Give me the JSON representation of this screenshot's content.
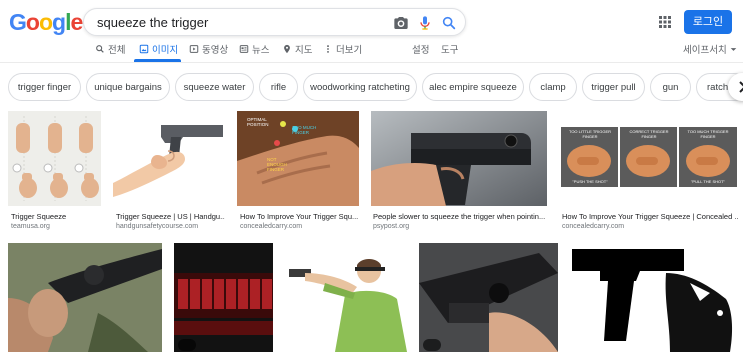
{
  "header": {
    "logo": "Google",
    "logo_colors": [
      "#4285f4",
      "#ea4335",
      "#fbbc05",
      "#4285f4",
      "#34a853",
      "#ea4335"
    ],
    "search_query": "squeeze the trigger",
    "login_label": "로그인"
  },
  "tabs": [
    {
      "label": "전체",
      "icon": "search-icon"
    },
    {
      "label": "이미지",
      "icon": "image-icon",
      "active": true
    },
    {
      "label": "동영상",
      "icon": "video-icon"
    },
    {
      "label": "뉴스",
      "icon": "news-icon"
    },
    {
      "label": "지도",
      "icon": "map-pin-icon"
    },
    {
      "label": "더보기",
      "icon": "more-icon"
    }
  ],
  "tools": {
    "settings": "설정",
    "tools": "도구",
    "safesearch": "세이프서치"
  },
  "chips": [
    "trigger finger",
    "unique bargains",
    "squeeze water",
    "rifle",
    "woodworking ratcheting",
    "alec empire squeeze",
    "clamp",
    "trigger pull",
    "gun",
    "ratche"
  ],
  "results_row1": [
    {
      "title": "Trigger Squeeze",
      "source": "teamusa.org"
    },
    {
      "title": "Trigger Squeeze | US | Handgu...",
      "source": "handgunsafetycourse.com"
    },
    {
      "title": "How To Improve Your Trigger Squ...",
      "source": "concealedcarry.com"
    },
    {
      "title": "People slower to squeeze the trigger when pointin...",
      "source": "psypost.org"
    },
    {
      "title": "How To Improve Your Trigger Squeeze | Concealed ...",
      "source": "concealedcarry.com"
    }
  ],
  "overlay_text": {
    "img3": [
      "OPTIMAL POSITION",
      "TOO MUCH FINGER",
      "NOT ENOUGH FINGER"
    ],
    "img5": [
      "TOO LITTLE TRIGGER FINGER",
      "CORRECT TRIGGER FINGER",
      "TOO MUCH TRIGGER FINGER",
      "\"PUSH THE SHOT\"",
      "\"PULL THE SHOT\""
    ]
  }
}
